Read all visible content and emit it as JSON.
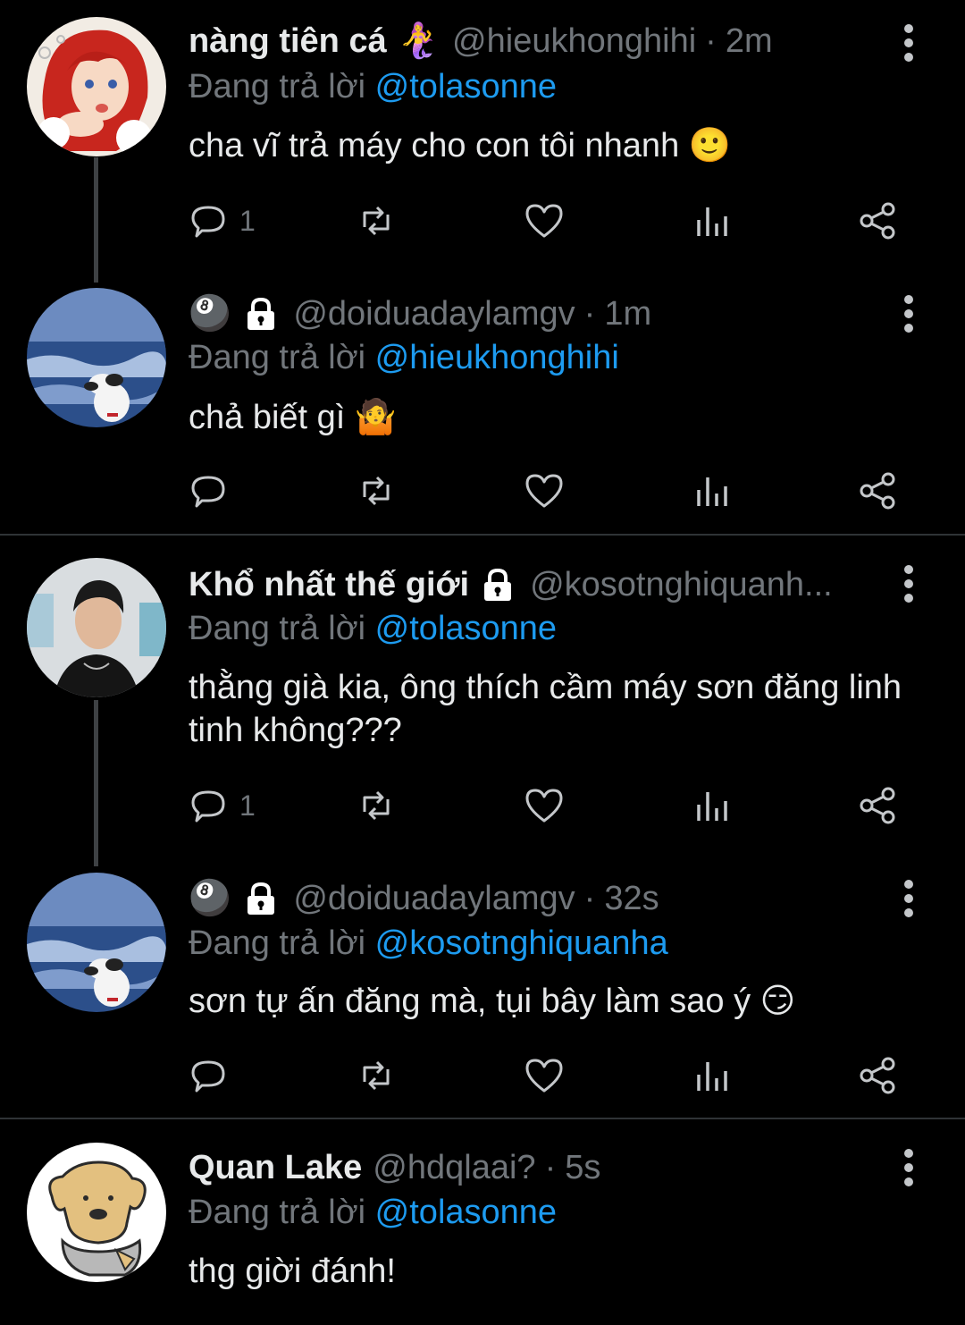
{
  "tweets": [
    {
      "name": "nàng tiên cá",
      "badge": "🧜‍♀️",
      "handle": "@hieukhonghihi",
      "time": "2m",
      "reply_prefix": "Đang trả lời",
      "reply_to": "@tolasonne",
      "text": "cha vĩ trả máy cho con tôi nhanh 🙂",
      "reply_count": "1"
    },
    {
      "name": "",
      "badge": "🎱",
      "handle": "@doiduadaylamgv",
      "time": "1m",
      "reply_prefix": "Đang trả lời",
      "reply_to": "@hieukhonghihi",
      "text": "chả biết gì 🤷",
      "reply_count": ""
    },
    {
      "name": "Khổ nhất thế giới",
      "badge": "",
      "handle": "@kosotnghiquanh...",
      "time": "",
      "reply_prefix": "Đang trả lời",
      "reply_to": "@tolasonne",
      "text": "thằng già kia, ông thích cầm máy sơn đăng linh tinh không???",
      "reply_count": "1"
    },
    {
      "name": "",
      "badge": "🎱",
      "handle": "@doiduadaylamgv",
      "time": "32s",
      "reply_prefix": "Đang trả lời",
      "reply_to": "@kosotnghiquanha",
      "text": "sơn tự ấn đăng mà, tụi bây làm sao ý 😏",
      "reply_count": ""
    },
    {
      "name": "Quan Lake",
      "badge": "",
      "handle": "@hdqlaai?",
      "time": "5s",
      "reply_prefix": "Đang trả lời",
      "reply_to": "@tolasonne",
      "text": "thg giời đánh!",
      "reply_count": ""
    }
  ],
  "separator": "·",
  "icons": {
    "reply": "reply-icon",
    "retweet": "retweet-icon",
    "like": "heart-icon",
    "views": "analytics-icon",
    "share": "share-icon",
    "more": "more-vertical-icon",
    "lock": "lock-icon"
  },
  "colors": {
    "background": "#000000",
    "text": "#e7e9ea",
    "muted": "#71767b",
    "mention": "#1d9bf0"
  }
}
